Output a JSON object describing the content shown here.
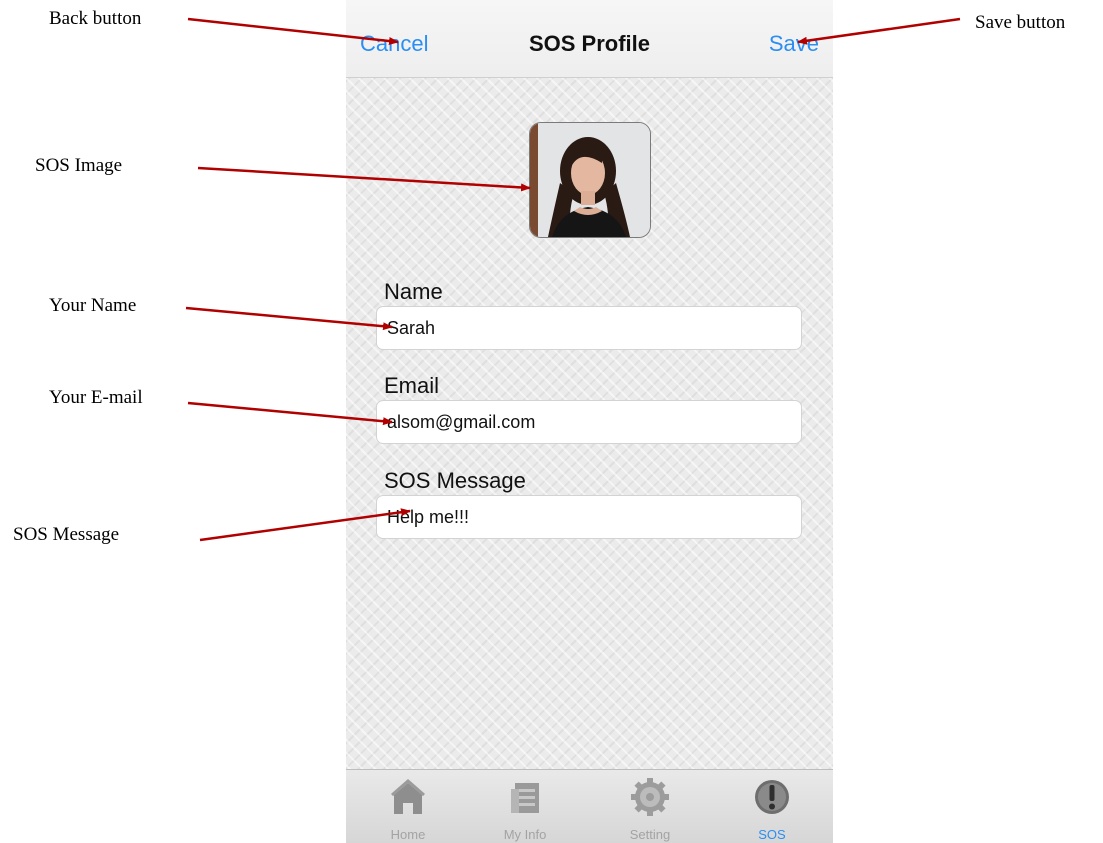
{
  "annotations": {
    "back_button": "Back button",
    "save_button": "Save button",
    "sos_image": "SOS Image",
    "your_name": "Your Name",
    "your_email": "Your E-mail",
    "sos_message": "SOS Message"
  },
  "navbar": {
    "cancel_label": "Cancel",
    "title": "SOS Profile",
    "save_label": "Save"
  },
  "form": {
    "name_label": "Name",
    "name_value": "Sarah",
    "email_label": "Email",
    "email_value": "alsom@gmail.com",
    "message_label": "SOS Message",
    "message_value": "Help me!!!"
  },
  "tabs": [
    {
      "label": "Home",
      "icon": "home-icon"
    },
    {
      "label": "My Info",
      "icon": "document-icon"
    },
    {
      "label": "Setting",
      "icon": "gear-icon"
    },
    {
      "label": "SOS",
      "icon": "exclamation-icon"
    }
  ],
  "active_tab": "SOS",
  "colors": {
    "accent": "#2a8ef2",
    "arrow": "#b00000",
    "tab_inactive": "#a3a3a3"
  }
}
